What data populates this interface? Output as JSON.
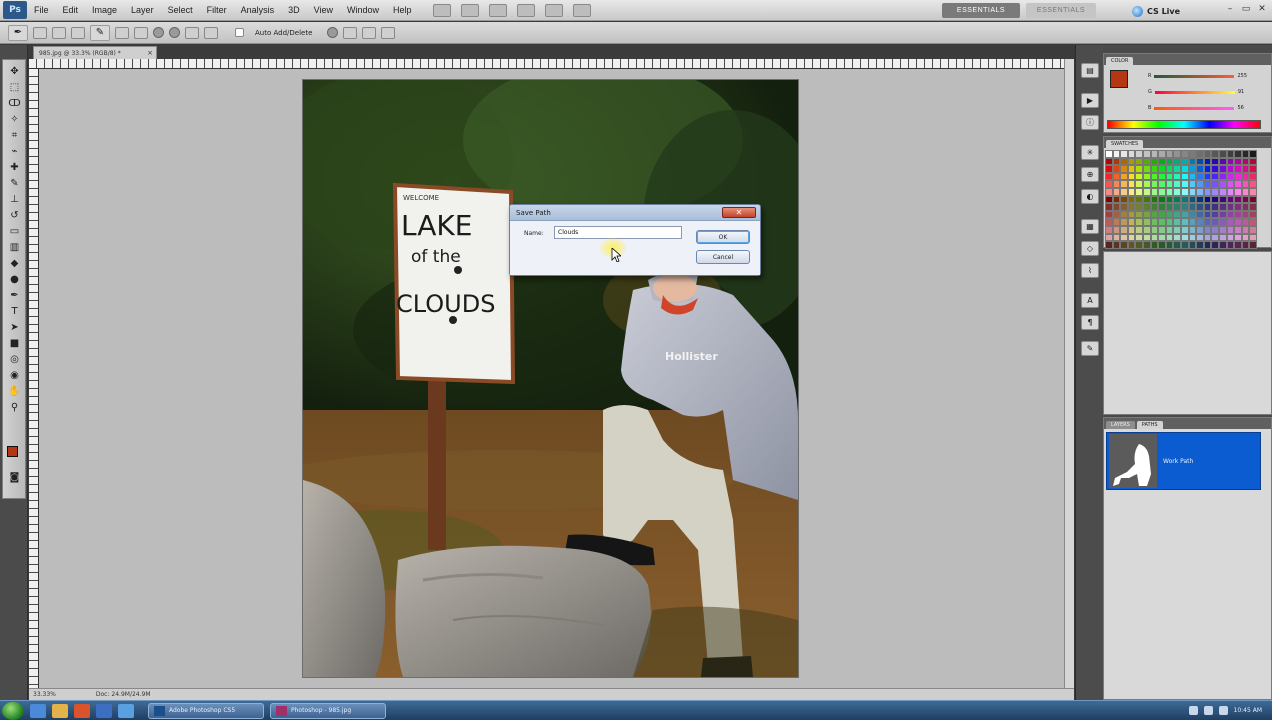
{
  "menubar": {
    "logo": "Ps",
    "items": [
      "File",
      "Edit",
      "Image",
      "Layer",
      "Select",
      "Filter",
      "Analysis",
      "3D",
      "View",
      "Window",
      "Help"
    ],
    "workspace_active": "ESSENTIALS",
    "workspace_other": "ESSENTIALS",
    "cslive": "CS Live",
    "win_minimize": "–",
    "win_restore": "▭",
    "win_close": "✕"
  },
  "options": {
    "auto_add_delete": "Auto Add/Delete"
  },
  "document": {
    "tab_label": "985.jpg @ 33.3% (RGB/8) *",
    "tab_close": "×",
    "zoom": "33.33%",
    "doc_size": "Doc: 24.9M/24.9M"
  },
  "photo": {
    "sign_line1": "LAKE",
    "sign_line2": "of the",
    "sign_line3": "CLOUDS",
    "sign_top": "WELCOME",
    "hoodie_text": "Hollister"
  },
  "panels": {
    "color_tab": "COLOR",
    "swatches_tab": "SWATCHES",
    "layers_tab": "LAYERS",
    "paths_tab": "PATHS",
    "path_item": "Work Path",
    "color_r": "255",
    "color_g": "91",
    "color_b": "56",
    "fg_color": "#b23714"
  },
  "dialog": {
    "title": "Save Path",
    "name_label": "Name:",
    "name_value": "Clouds",
    "ok_label": "OK",
    "cancel_label": "Cancel",
    "close_glyph": "✕"
  },
  "taskbar": {
    "btn1": "Adobe Photoshop CS5",
    "btn2": "Photoshop - 985.jpg",
    "clock": "10:45 AM"
  }
}
